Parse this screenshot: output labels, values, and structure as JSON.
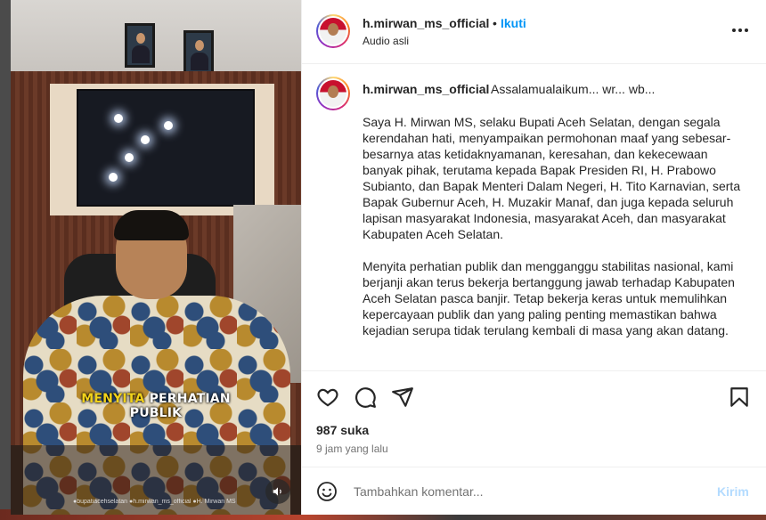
{
  "post": {
    "username": "h.mirwan_ms_official",
    "separator": "•",
    "follow_label": "Ikuti",
    "audio_label": "Audio asli",
    "more_icon": "more-horizontal-icon"
  },
  "video": {
    "caption_highlight": "MENYITA",
    "caption_rest_line1": " PERHATIAN",
    "caption_line2": "PUBLIK",
    "watermark": "●bupatiacehselatan  ●h.mirwan_ms_official  ●H. Mirwan MS",
    "audio_icon": "speaker-icon"
  },
  "caption": {
    "username": "h.mirwan_ms_official",
    "first_line": "Assalamualaikum... wr... wb...",
    "paragraphs": [
      "Saya H. Mirwan MS, selaku Bupati Aceh Selatan, dengan segala kerendahan hati, menyampaikan permohonan maaf yang sebesar-besarnya atas ketidaknyamanan, keresahan, dan kekecewaan banyak pihak, terutama kepada Bapak Presiden RI, H. Prabowo Subianto, dan Bapak Menteri Dalam Negeri, H. Tito Karnavian, serta Bapak Gubernur Aceh, H. Muzakir Manaf, dan juga kepada seluruh lapisan masyarakat Indonesia, masyarakat Aceh, dan masyarakat Kabupaten Aceh Selatan.",
      "Menyita perhatian publik dan mengganggu stabilitas nasional, kami berjanji akan terus bekerja bertanggung jawab terhadap Kabupaten Aceh Selatan pasca banjir. Tetap bekerja keras untuk memulihkan kepercayaan publik dan yang paling penting memastikan bahwa kejadian serupa tidak terulang kembali di masa yang akan datang."
    ]
  },
  "actions": {
    "icons": [
      "heart-icon",
      "comment-icon",
      "share-icon",
      "bookmark-icon"
    ],
    "likes": "987 suka",
    "time": "9 jam yang lalu"
  },
  "comment_box": {
    "placeholder": "Tambahkan komentar...",
    "send_label": "Kirim",
    "emoji_icon": "emoji-icon"
  },
  "colors": {
    "accent": "#0095f6",
    "send_disabled": "#b3dbff",
    "text": "#262626",
    "muted": "#737373",
    "caption_highlight": "#f2d21a"
  }
}
